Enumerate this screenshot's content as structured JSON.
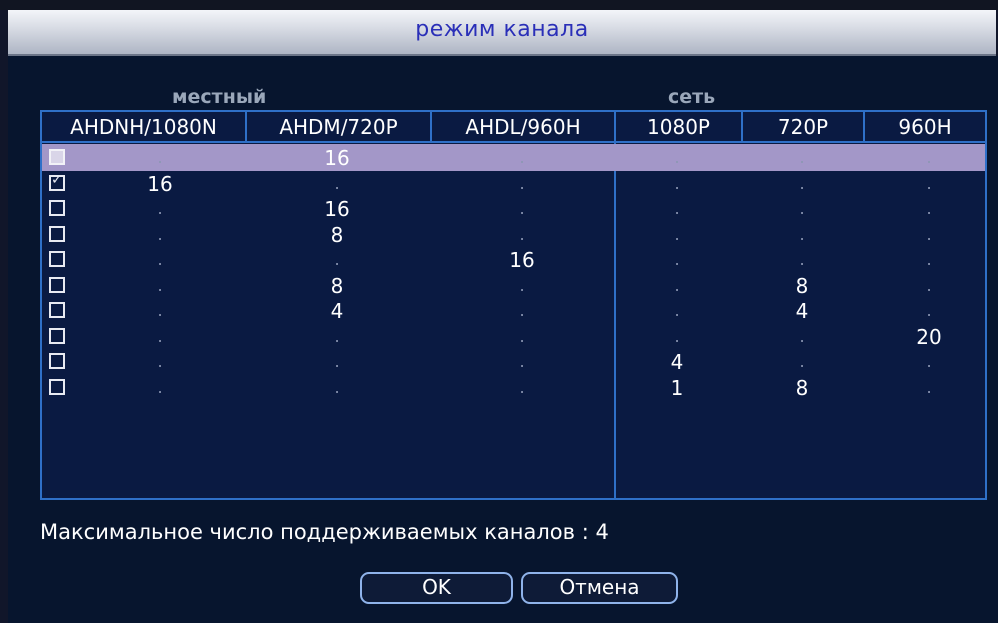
{
  "window": {
    "title": "режим канала"
  },
  "sections": {
    "local": "местный",
    "network": "сеть"
  },
  "columns": [
    "AHDNH/1080N",
    "AHDM/720P",
    "AHDL/960H",
    "1080P",
    "720P",
    "960H"
  ],
  "rows": [
    {
      "checked": false,
      "highlighted": true,
      "values": [
        ".",
        "16",
        ".",
        ".",
        ".",
        "."
      ]
    },
    {
      "checked": true,
      "highlighted": false,
      "values": [
        "16",
        ".",
        ".",
        ".",
        ".",
        "."
      ]
    },
    {
      "checked": false,
      "highlighted": false,
      "values": [
        ".",
        "16",
        ".",
        ".",
        ".",
        "."
      ]
    },
    {
      "checked": false,
      "highlighted": false,
      "values": [
        ".",
        "8",
        ".",
        ".",
        ".",
        "."
      ]
    },
    {
      "checked": false,
      "highlighted": false,
      "values": [
        ".",
        ".",
        "16",
        ".",
        ".",
        "."
      ]
    },
    {
      "checked": false,
      "highlighted": false,
      "values": [
        ".",
        "8",
        ".",
        ".",
        "8",
        "."
      ]
    },
    {
      "checked": false,
      "highlighted": false,
      "values": [
        ".",
        "4",
        ".",
        ".",
        "4",
        "."
      ]
    },
    {
      "checked": false,
      "highlighted": false,
      "values": [
        ".",
        ".",
        ".",
        ".",
        ".",
        "20"
      ]
    },
    {
      "checked": false,
      "highlighted": false,
      "values": [
        ".",
        ".",
        ".",
        "4",
        ".",
        "."
      ]
    },
    {
      "checked": false,
      "highlighted": false,
      "values": [
        ".",
        ".",
        ".",
        "1",
        "8",
        "."
      ]
    }
  ],
  "max_channels_text": "Максимальное число поддерживаемых каналов : 4",
  "buttons": {
    "ok": "OK",
    "cancel": "Отмена"
  },
  "colors": {
    "highlight_row": "#a397c8",
    "grid_border": "#2f70c8",
    "title_text": "#2a2fb8"
  }
}
